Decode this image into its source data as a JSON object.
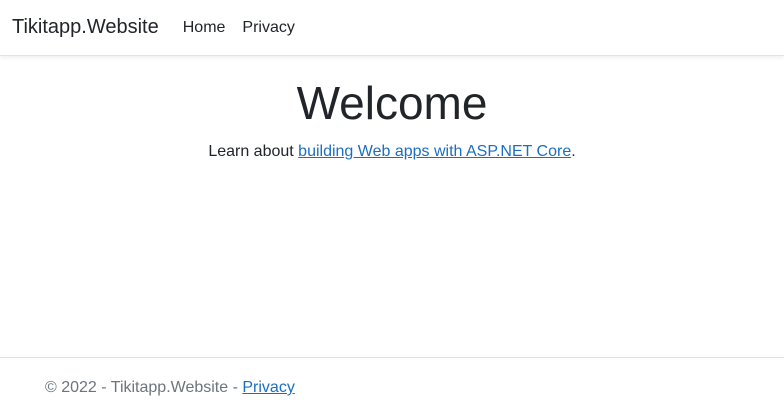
{
  "navbar": {
    "brand": "Tikitapp.Website",
    "links": [
      {
        "label": "Home"
      },
      {
        "label": "Privacy"
      }
    ]
  },
  "main": {
    "heading": "Welcome",
    "intro_prefix": "Learn about ",
    "intro_link": "building Web apps with ASP.NET Core",
    "intro_suffix": "."
  },
  "footer": {
    "copyright": "© 2022 - Tikitapp.Website - ",
    "privacy_link": "Privacy"
  },
  "colors": {
    "text": "#212529",
    "link": "#1b6ec2",
    "muted": "#6c757d",
    "border": "#dee2e6"
  }
}
